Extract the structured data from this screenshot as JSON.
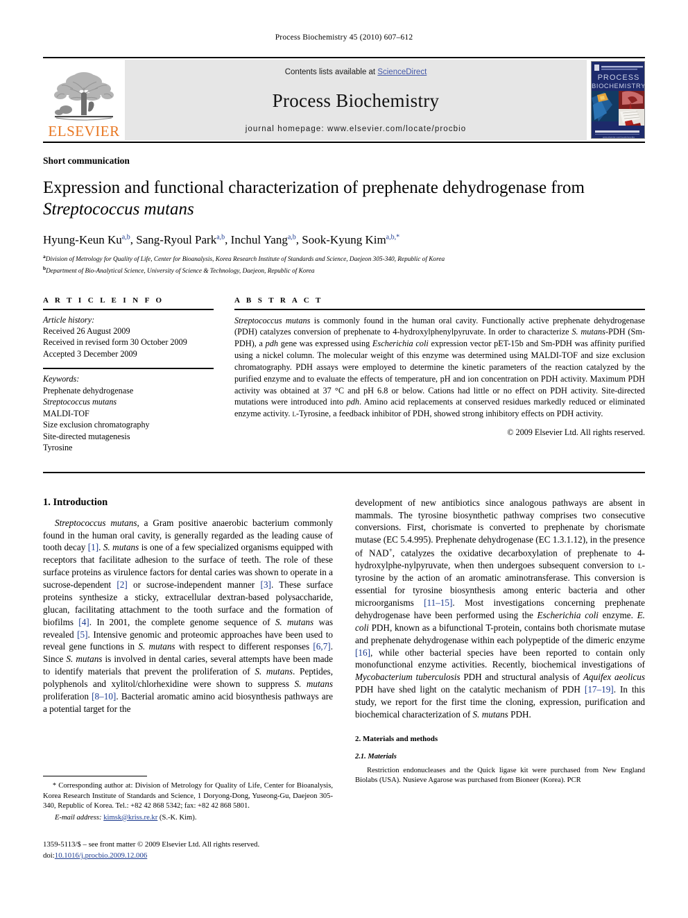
{
  "running_head": "Process Biochemistry 45 (2010) 607–612",
  "masthead": {
    "contents_prefix": "Contents lists available at ",
    "sciencedirect": "ScienceDirect",
    "journal_title": "Process Biochemistry",
    "homepage": "journal homepage: www.elsevier.com/locate/procbio",
    "publisher_wordmark": "ELSEVIER",
    "publisher_color": "#e87722",
    "link_color": "#4257a8",
    "cover": {
      "line1": "PROCESS",
      "line2": "BIOCHEMISTRY",
      "bg_color": "#1d2a6b"
    }
  },
  "article": {
    "kind": "Short communication",
    "title_line1": "Expression and functional characterization of prephenate dehydrogenase from",
    "title_species": "Streptococcus mutans",
    "authors": [
      {
        "name": "Hyung-Keun Ku",
        "marks": "a,b",
        "sep": ", "
      },
      {
        "name": "Sang-Ryoul Park",
        "marks": "a,b",
        "sep": ", "
      },
      {
        "name": "Inchul Yang",
        "marks": "a,b",
        "sep": ", "
      },
      {
        "name": "Sook-Kyung Kim",
        "marks": "a,b,*",
        "sep": ""
      }
    ],
    "affiliations": [
      {
        "mark": "a",
        "text": "Division of Metrology for Quality of Life, Center for Bioanalysis, Korea Research Institute of Standards and Science, Daejeon 305-340, Republic of Korea"
      },
      {
        "mark": "b",
        "text": "Department of Bio-Analytical Science, University of Science & Technology, Daejeon, Republic of Korea"
      }
    ]
  },
  "article_info": {
    "heading": "A R T I C L E  I N F O",
    "history_label": "Article history:",
    "history": [
      "Received 26 August 2009",
      "Received in revised form 30 October 2009",
      "Accepted 3 December 2009"
    ],
    "keywords_label": "Keywords:",
    "keywords": [
      "Prephenate dehydrogenase",
      "Streptococcus mutans",
      "MALDI-TOF",
      "Size exclusion chromatography",
      "Site-directed mutagenesis",
      "Tyrosine"
    ],
    "keyword_italic_index": 1
  },
  "abstract": {
    "heading": "A B S T R A C T",
    "text_html": "<span class=\"it\">Streptococcus mutans</span> is commonly found in the human oral cavity. Functionally active prephenate dehydrogenase (PDH) catalyzes conversion of prephenate to 4-hydroxylphenylpyruvate. In order to characterize <span class=\"it\">S. mutans</span>-PDH (Sm-PDH), a <span class=\"it\">pdh</span> gene was expressed using <span class=\"it\">Escherichia coli</span> expression vector pET-15b and Sm-PDH was affinity purified using a nickel column. The molecular weight of this enzyme was determined using MALDI-TOF and size exclusion chromatography. PDH assays were employed to determine the kinetic parameters of the reaction catalyzed by the purified enzyme and to evaluate the effects of temperature, pH and ion concentration on PDH activity. Maximum PDH activity was obtained at 37 °C and pH 6.8 or below. Cations had little or no effect on PDH activity. Site-directed mutations were introduced into <span class=\"it\">pdh</span>. Amino acid replacements at conserved residues markedly reduced or eliminated enzyme activity. <span style=\"font-variant:small-caps\">l</span>-Tyrosine, a feedback inhibitor of PDH, showed strong inhibitory effects on PDH activity.",
    "copyright": "© 2009 Elsevier Ltd. All rights reserved."
  },
  "sections": {
    "intro_heading": "1. Introduction",
    "intro_p1_html": "<span class=\"it\">Streptococcus mutans</span>, a Gram positive anaerobic bacterium commonly found in the human oral cavity, is generally regarded as the leading cause of tooth decay <span class=\"ref\">[1]</span>. <span class=\"it\">S. mutans</span> is one of a few specialized organisms equipped with receptors that facilitate adhesion to the surface of teeth. The role of these surface proteins as virulence factors for dental caries was shown to operate in a sucrose-dependent <span class=\"ref\">[2]</span> or sucrose-independent manner <span class=\"ref\">[3]</span>. These surface proteins synthesize a sticky, extracellular dextran-based polysaccharide, glucan, facilitating attachment to the tooth surface and the formation of biofilms <span class=\"ref\">[4]</span>. In 2001, the complete genome sequence of <span class=\"it\">S. mutans</span> was revealed <span class=\"ref\">[5]</span>. Intensive genomic and proteomic approaches have been used to reveal gene functions in <span class=\"it\">S. mutans</span> with respect to different responses <span class=\"ref\">[6,7]</span>. Since <span class=\"it\">S. mutans</span> is involved in dental caries, several attempts have been made to identify materials that prevent the proliferation of <span class=\"it\">S. mutans</span>. Peptides, polyphenols and xylitol/chlorhexidine were shown to suppress <span class=\"it\">S. mutans</span> proliferation <span class=\"ref\">[8–10]</span>. Bacterial aromatic amino acid biosynthesis pathways are a potential target for the",
    "intro_p1_cont_html": "development of new antibiotics since analogous pathways are absent in mammals. The tyrosine biosynthetic pathway comprises two consecutive conversions. First, chorismate is converted to prephenate by chorismate mutase (EC 5.4.995). Prephenate dehydrogenase (EC 1.3.1.12), in the presence of NAD<sup class=\"plus\">+</sup>, catalyzes the oxidative decarboxylation of prephenate to 4-hydroxylphe-nylpyruvate, when then undergoes subsequent conversion to <span style=\"font-variant:small-caps\">l</span>-tyrosine by the action of an aromatic aminotransferase. This conversion is essential for tyrosine biosynthesis among enteric bacteria and other microorganisms <span class=\"ref\">[11–15]</span>. Most investigations concerning prephenate dehydrogenase have been performed using the <span class=\"it\">Escherichia coli</span> enzyme. <span class=\"it\">E. coli</span> PDH, known as a bifunctional T-protein, contains both chorismate mutase and prephenate dehydrogenase within each polypeptide of the dimeric enzyme <span class=\"ref\">[16]</span>, while other bacterial species have been reported to contain only monofunctional enzyme activities. Recently, biochemical investigations of <span class=\"it\">Mycobacterium tuberculosis</span> PDH and structural analysis of <span class=\"it\">Aquifex aeolicus</span> PDH have shed light on the catalytic mechanism of PDH <span class=\"ref\">[17–19]</span>. In this study, we report for the first time the cloning, expression, purification and biochemical characterization of <span class=\"it\">S. mutans</span> PDH.",
    "methods_heading": "2. Materials and methods",
    "materials_subheading": "2.1. Materials",
    "materials_p_html": "Restriction endonucleases and the Quick ligase kit were purchased from New England Biolabs (USA). Nusieve Agarose was purchased from Bioneer (Korea). PCR"
  },
  "footnotes": {
    "corresponding_html": "<span class=\"star\">*</span> Corresponding author at: Division of Metrology for Quality of Life, Center for Bioanalysis, Korea Research Institute of Standards and Science, 1 Doryong-Dong, Yuseong-Gu, Daejeon 305-340, Republic of Korea. Tel.: +82 42 868 5342; fax: +82 42 868 5801.",
    "email_label": "E-mail address:",
    "email": "kimsk@kriss.re.kr",
    "email_suffix": "(S.-K. Kim).",
    "imprint_line1": "1359-5113/$ – see front matter © 2009 Elsevier Ltd. All rights reserved.",
    "imprint_doi_label": "doi:",
    "imprint_doi": "10.1016/j.procbio.2009.12.006"
  }
}
